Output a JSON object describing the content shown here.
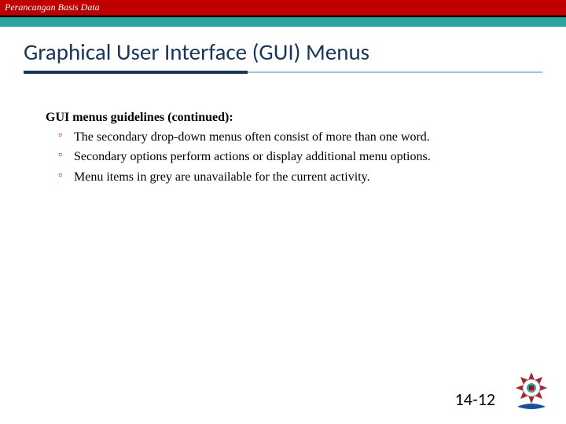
{
  "header": {
    "course": "Perancangan Basis Data"
  },
  "title": "Graphical User Interface (GUI) Menus",
  "content": {
    "lead": "GUI menus guidelines (continued):",
    "bullets": [
      "The secondary drop-down menus often consist of more than one word.",
      "Secondary options perform actions or display additional menu options.",
      "Menu items in grey are unavailable for the current activity."
    ]
  },
  "page_number": "14-12"
}
